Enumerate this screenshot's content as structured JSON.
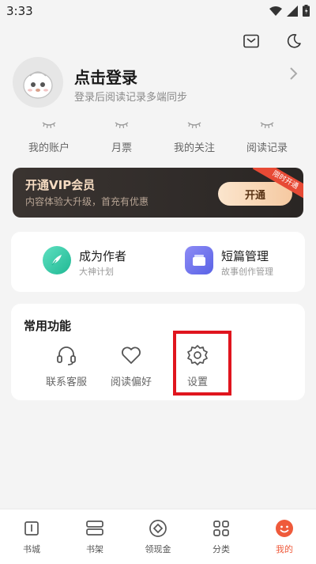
{
  "status_bar": {
    "time": "3:33"
  },
  "profile": {
    "title": "点击登录",
    "subtitle": "登录后阅读记录多端同步"
  },
  "stats": [
    {
      "label": "我的账户"
    },
    {
      "label": "月票"
    },
    {
      "label": "我的关注"
    },
    {
      "label": "阅读记录"
    }
  ],
  "vip": {
    "title": "开通VIP会员",
    "subtitle": "内容体验大升级，首充有优惠",
    "button": "开通",
    "ribbon": "限时开通"
  },
  "creator": {
    "author": {
      "title": "成为作者",
      "subtitle": "大神计划"
    },
    "shorts": {
      "title": "短篇管理",
      "subtitle": "故事创作管理"
    }
  },
  "common": {
    "title": "常用功能",
    "items": [
      {
        "label": "联系客服",
        "icon": "headset-icon"
      },
      {
        "label": "阅读偏好",
        "icon": "heart-icon"
      },
      {
        "label": "设置",
        "icon": "gear-icon"
      }
    ]
  },
  "tabs": [
    {
      "label": "书城",
      "icon": "book-icon"
    },
    {
      "label": "书架",
      "icon": "bookshelf-icon"
    },
    {
      "label": "领现金",
      "icon": "coin-icon"
    },
    {
      "label": "分类",
      "icon": "grid-icon"
    },
    {
      "label": "我的",
      "icon": "smile-icon",
      "active": true
    }
  ],
  "colors": {
    "accent": "#ef5a3b",
    "highlight": "#e0151e",
    "vip_gold": "#f6dcc2"
  }
}
